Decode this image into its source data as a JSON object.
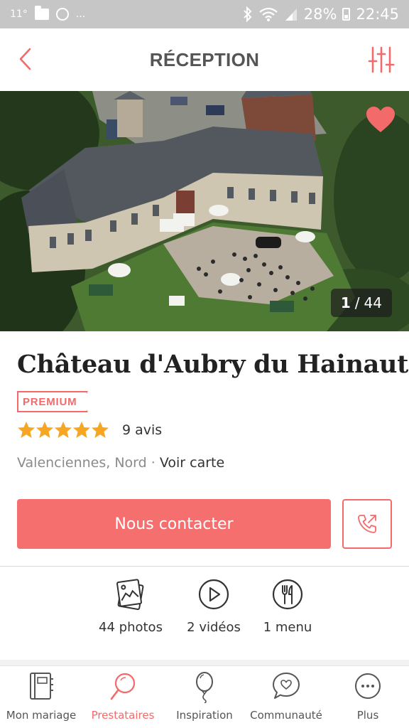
{
  "status_bar": {
    "temperature": "11°",
    "dots": "...",
    "battery": "28%",
    "time": "22:45"
  },
  "header": {
    "title": "RÉCEPTION",
    "back_icon": "chevron-left-icon",
    "filter_icon": "sliders-icon"
  },
  "gallery": {
    "current": "1",
    "separator": "/",
    "total": "44",
    "favorite_icon": "heart-icon",
    "favorited": true
  },
  "venue": {
    "name": "Château d'Aubry du Hainaut",
    "badge": "PREMIUM",
    "rating": 5,
    "rating_max": 5,
    "reviews": "9 avis",
    "location": "Valenciennes, Nord",
    "separator": "·",
    "map_link": "Voir carte"
  },
  "actions": {
    "contact_label": "Nous contacter",
    "call_icon": "phone-outgoing-icon"
  },
  "media": [
    {
      "icon": "photos-icon",
      "label": "44 photos"
    },
    {
      "icon": "play-icon",
      "label": "2 vidéos"
    },
    {
      "icon": "fork-knife-icon",
      "label": "1 menu"
    }
  ],
  "nav": [
    {
      "icon": "notebook-icon",
      "label": "Mon mariage",
      "active": false
    },
    {
      "icon": "magnifier-icon",
      "label": "Prestataires",
      "active": true
    },
    {
      "icon": "balloon-icon",
      "label": "Inspiration",
      "active": false
    },
    {
      "icon": "chat-heart-icon",
      "label": "Communauté",
      "active": false
    },
    {
      "icon": "more-icon",
      "label": "Plus",
      "active": false
    }
  ],
  "colors": {
    "accent": "#f36a6a",
    "star": "#f6a623",
    "status_bar": "#c6c6c6"
  }
}
